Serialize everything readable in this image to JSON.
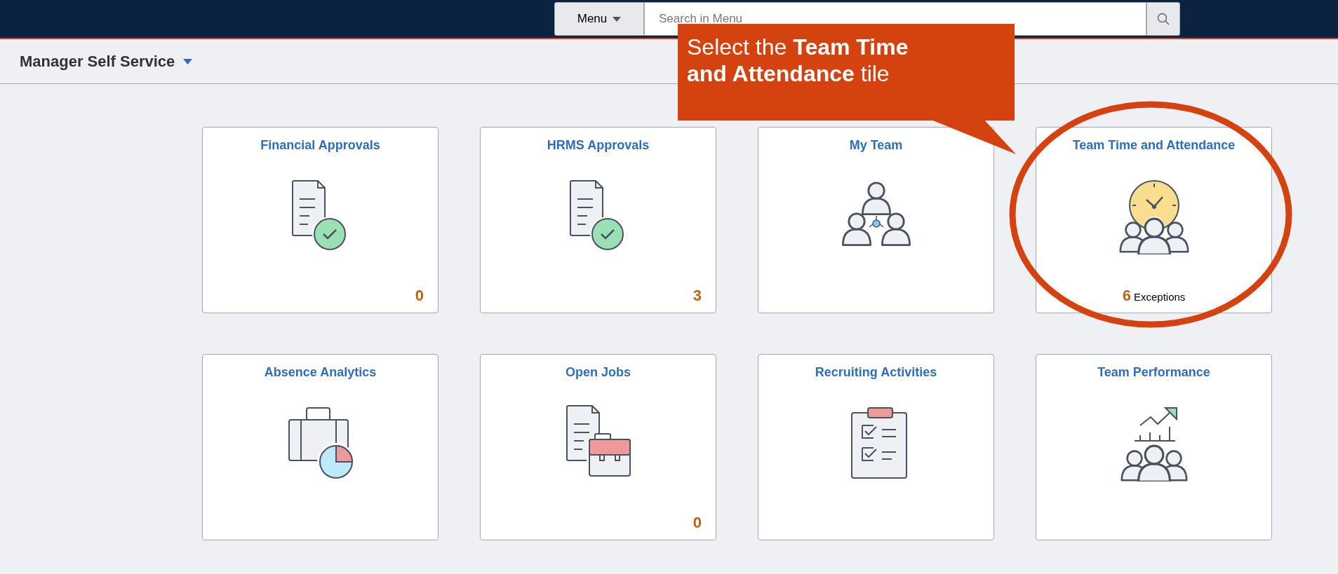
{
  "top_bar": {
    "menu_button": "Menu",
    "search": {
      "placeholder": "Search in Menu"
    }
  },
  "header": {
    "title": "Manager Self Service"
  },
  "tiles": [
    {
      "title": "Financial Approvals",
      "kind": "approvals",
      "count": "0"
    },
    {
      "title": "HRMS Approvals",
      "kind": "approvals",
      "count": "3"
    },
    {
      "title": "My Team",
      "kind": "team"
    },
    {
      "title": "Team Time and Attendance",
      "kind": "attendance",
      "count": "6",
      "count_label": "Exceptions"
    },
    {
      "title": "Absence Analytics",
      "kind": "analytics"
    },
    {
      "title": "Open Jobs",
      "kind": "jobs",
      "count": "0"
    },
    {
      "title": "Recruiting Activities",
      "kind": "recruiting"
    },
    {
      "title": "Team Performance",
      "kind": "performance"
    }
  ],
  "callout": {
    "text": "Select the **Team Time and Attendance** tile"
  }
}
